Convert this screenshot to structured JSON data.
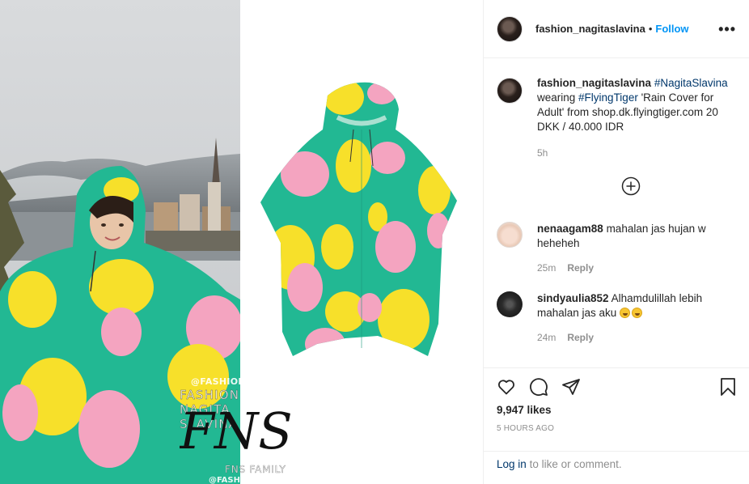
{
  "post": {
    "username": "fashion_nagitaslavina",
    "separator": "•",
    "follow_label": "Follow",
    "more_icon": "more-options-icon",
    "more_glyph": "•••"
  },
  "caption": {
    "username": "fashion_nagitaslavina",
    "tag1": "#NagitaSlavina",
    "text1": "wearing",
    "tag2": "#FlyingTiger",
    "text2": "'Rain Cover for Adult' from shop.dk.flyingtiger.com 20 DKK / 40.000 IDR",
    "time": "5h"
  },
  "comments": [
    {
      "username": "nenaagam88",
      "text": "mahalan jas hujan w heheheh",
      "time": "25m",
      "reply_label": "Reply"
    },
    {
      "username": "sindyaulia852",
      "text": "Alhamdulillah lebih mahalan jas aku",
      "time": "24m",
      "reply_label": "Reply"
    }
  ],
  "stats": {
    "likes": "9,947 likes",
    "time_ago": "5 HOURS AGO"
  },
  "footer": {
    "login_link": "Log in",
    "login_text": "to like or comment."
  },
  "watermark": {
    "handle": "@FASHION_NAGITASLAVINA",
    "name": "FASHION NAGITA SLAVINA",
    "monogram": "FNS",
    "family": "FNS FAMILY",
    "handle_bottom": "@FASHION_NAGITASLAVINA"
  },
  "colors": {
    "poncho_green": "#22b893",
    "poncho_pink": "#f4a4c0",
    "poncho_yellow": "#f7e02a",
    "follow_blue": "#0095f6",
    "link_navy": "#00376b"
  }
}
